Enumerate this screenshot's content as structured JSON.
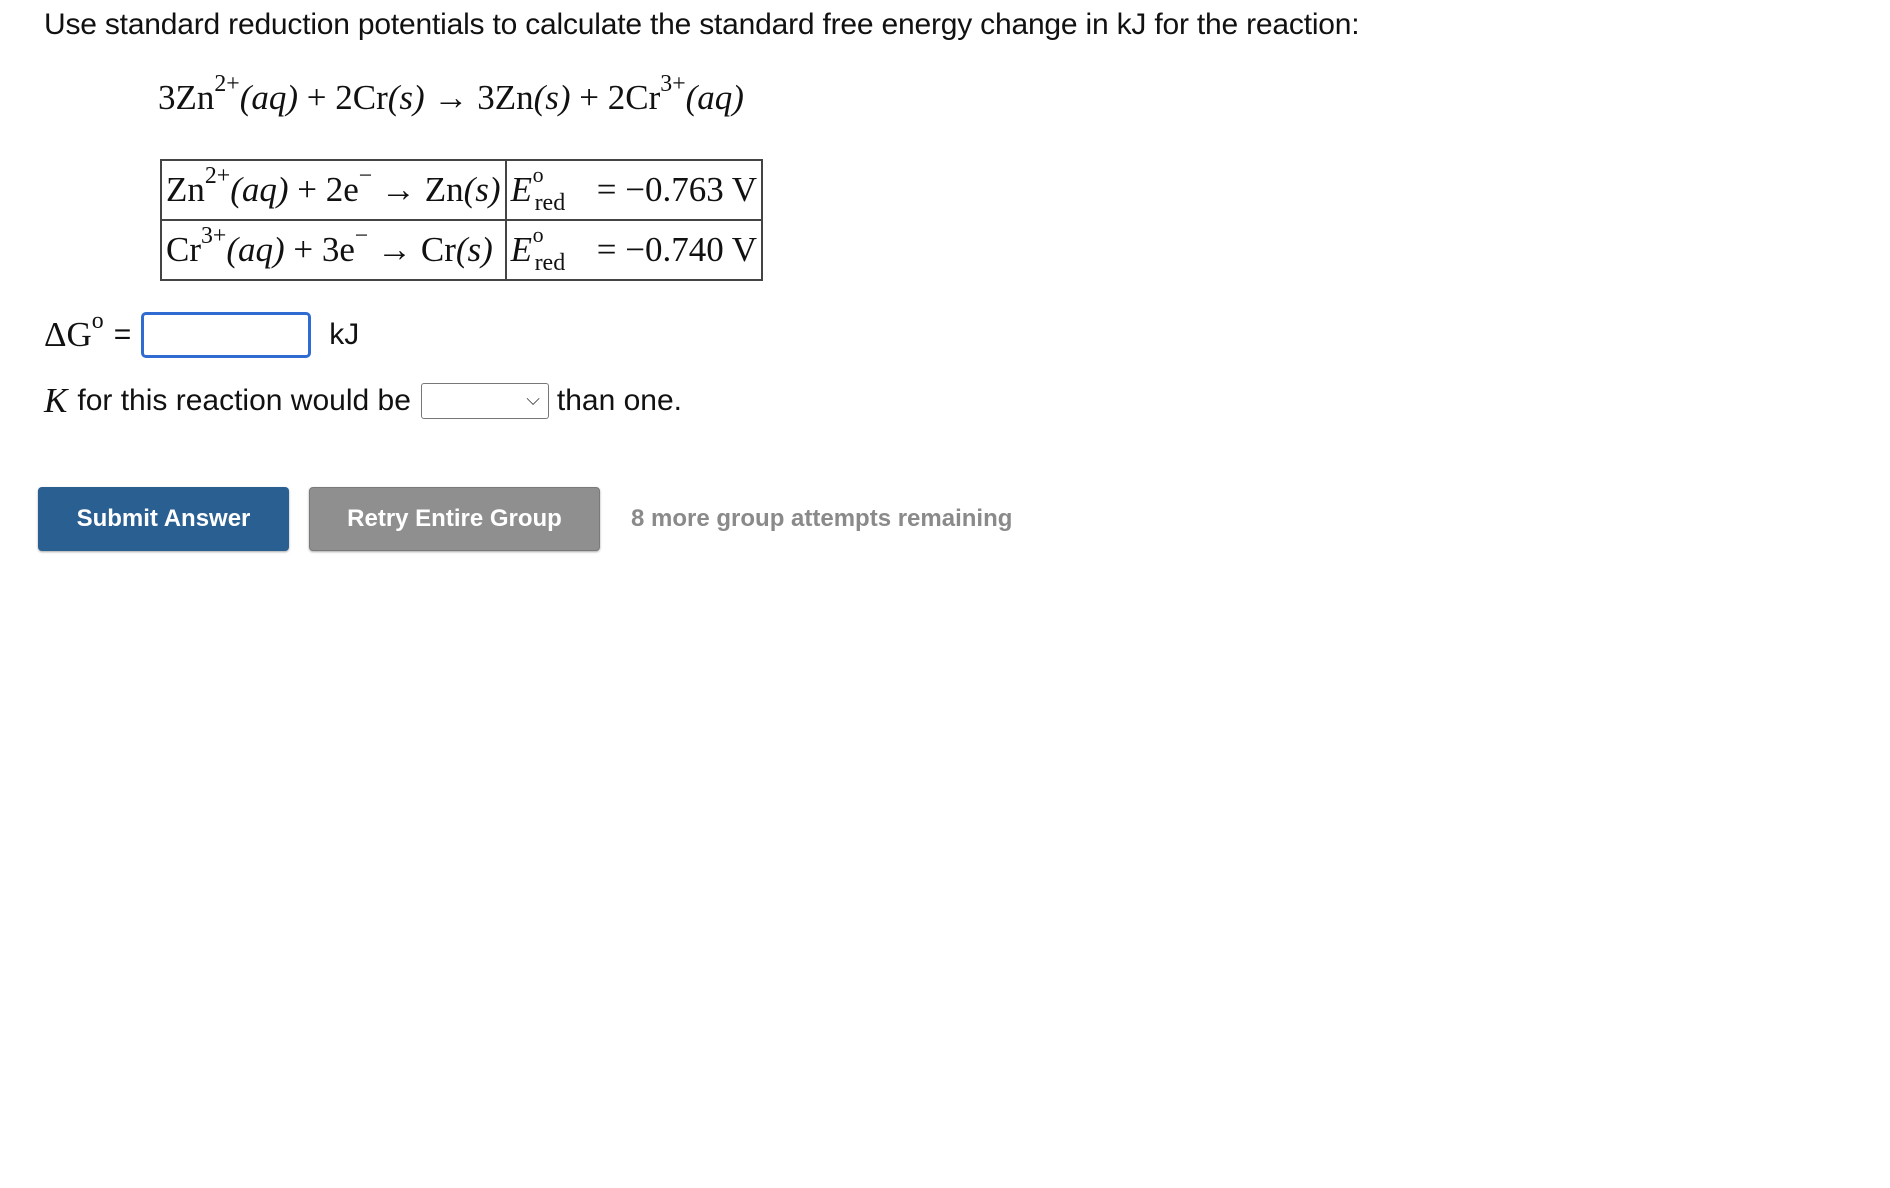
{
  "prompt": "Use standard reduction potentials to calculate the standard free energy change in kJ for the reaction:",
  "reaction": {
    "r1_coef": "3Zn",
    "r1_charge": "2+",
    "r1_state": "(aq)",
    "plus1": "+",
    "r2": "2Cr",
    "r2_state": "(s)",
    "arrow": "→",
    "p1": "3Zn",
    "p1_state": "(s)",
    "plus2": "+",
    "p2_coef": "2Cr",
    "p2_charge": "3+",
    "p2_state": "(aq)"
  },
  "half_reactions": [
    {
      "ion": "Zn",
      "charge": "2+",
      "state": "(aq)",
      "electrons": "+ 2e",
      "e_sign": "−",
      "arrow": "→",
      "product": "Zn",
      "product_state": "(s)",
      "e_symbol": "E",
      "e_super": "o",
      "e_sub": "red",
      "equals": "=",
      "value": "−0.763 V"
    },
    {
      "ion": "Cr",
      "charge": "3+",
      "state": "(aq)",
      "electrons": "+ 3e",
      "e_sign": "−",
      "arrow": "→",
      "product": "Cr",
      "product_state": "(s)",
      "e_symbol": "E",
      "e_super": "o",
      "e_sub": "red",
      "equals": "=",
      "value": "−0.740 V"
    }
  ],
  "delta_g": {
    "symbol": "ΔG",
    "super": "o",
    "equals": "=",
    "value": "",
    "placeholder": "",
    "unit": "kJ"
  },
  "k_question": {
    "symbol": "K",
    "before": "for this reaction would be",
    "selected": "",
    "after": "than one."
  },
  "buttons": {
    "submit": "Submit Answer",
    "retry": "Retry Entire Group"
  },
  "attempts_text": "8 more group attempts remaining",
  "colors": {
    "submit_bg": "#2a5f92",
    "retry_bg": "#8f8f8f",
    "input_border": "#2f6bd0",
    "attempts_text": "#8a8a8a"
  }
}
